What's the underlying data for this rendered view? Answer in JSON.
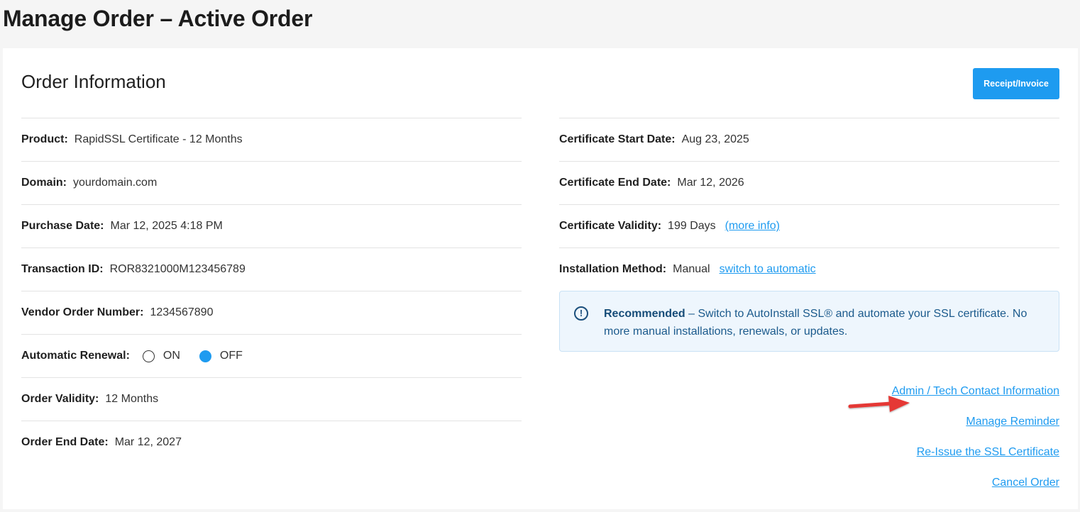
{
  "page": {
    "title": "Manage Order – Active Order"
  },
  "order": {
    "section_title": "Order Information",
    "receipt_button": "Receipt/Invoice",
    "left_rows": [
      {
        "label": "Product:",
        "value": "RapidSSL Certificate - 12 Months"
      },
      {
        "label": "Domain:",
        "value": "yourdomain.com"
      },
      {
        "label": "Purchase Date:",
        "value": "Mar 12, 2025 4:18 PM"
      },
      {
        "label": "Transaction ID:",
        "value": "ROR8321000M123456789"
      },
      {
        "label": "Vendor Order Number:",
        "value": "1234567890"
      },
      {
        "label": "Automatic Renewal:",
        "option_on": "ON",
        "option_off": "OFF",
        "selected": "OFF"
      },
      {
        "label": "Order Validity:",
        "value": "12 Months"
      },
      {
        "label": "Order End Date:",
        "value": "Mar 12, 2027"
      }
    ],
    "right_rows": [
      {
        "label": "Certificate Start Date:",
        "value": "Aug 23, 2025"
      },
      {
        "label": "Certificate End Date:",
        "value": "Mar 12, 2026"
      },
      {
        "label": "Certificate Validity:",
        "value": "199 Days",
        "link": "(more info)"
      },
      {
        "label": "Installation Method:",
        "value": "Manual",
        "link": "switch to automatic"
      }
    ],
    "notice": {
      "icon": "info-icon",
      "strong": "Recommended",
      "text": " – Switch to AutoInstall SSL® and automate your SSL certificate. No more manual installations, renewals, or updates."
    },
    "actions": [
      "Admin / Tech Contact Information",
      "Manage Reminder",
      "Re-Issue the SSL Certificate",
      "Cancel Order"
    ]
  },
  "colors": {
    "accent": "#1e9bf0",
    "arrow": "#e53935",
    "notice_bg": "#eef6fd"
  }
}
